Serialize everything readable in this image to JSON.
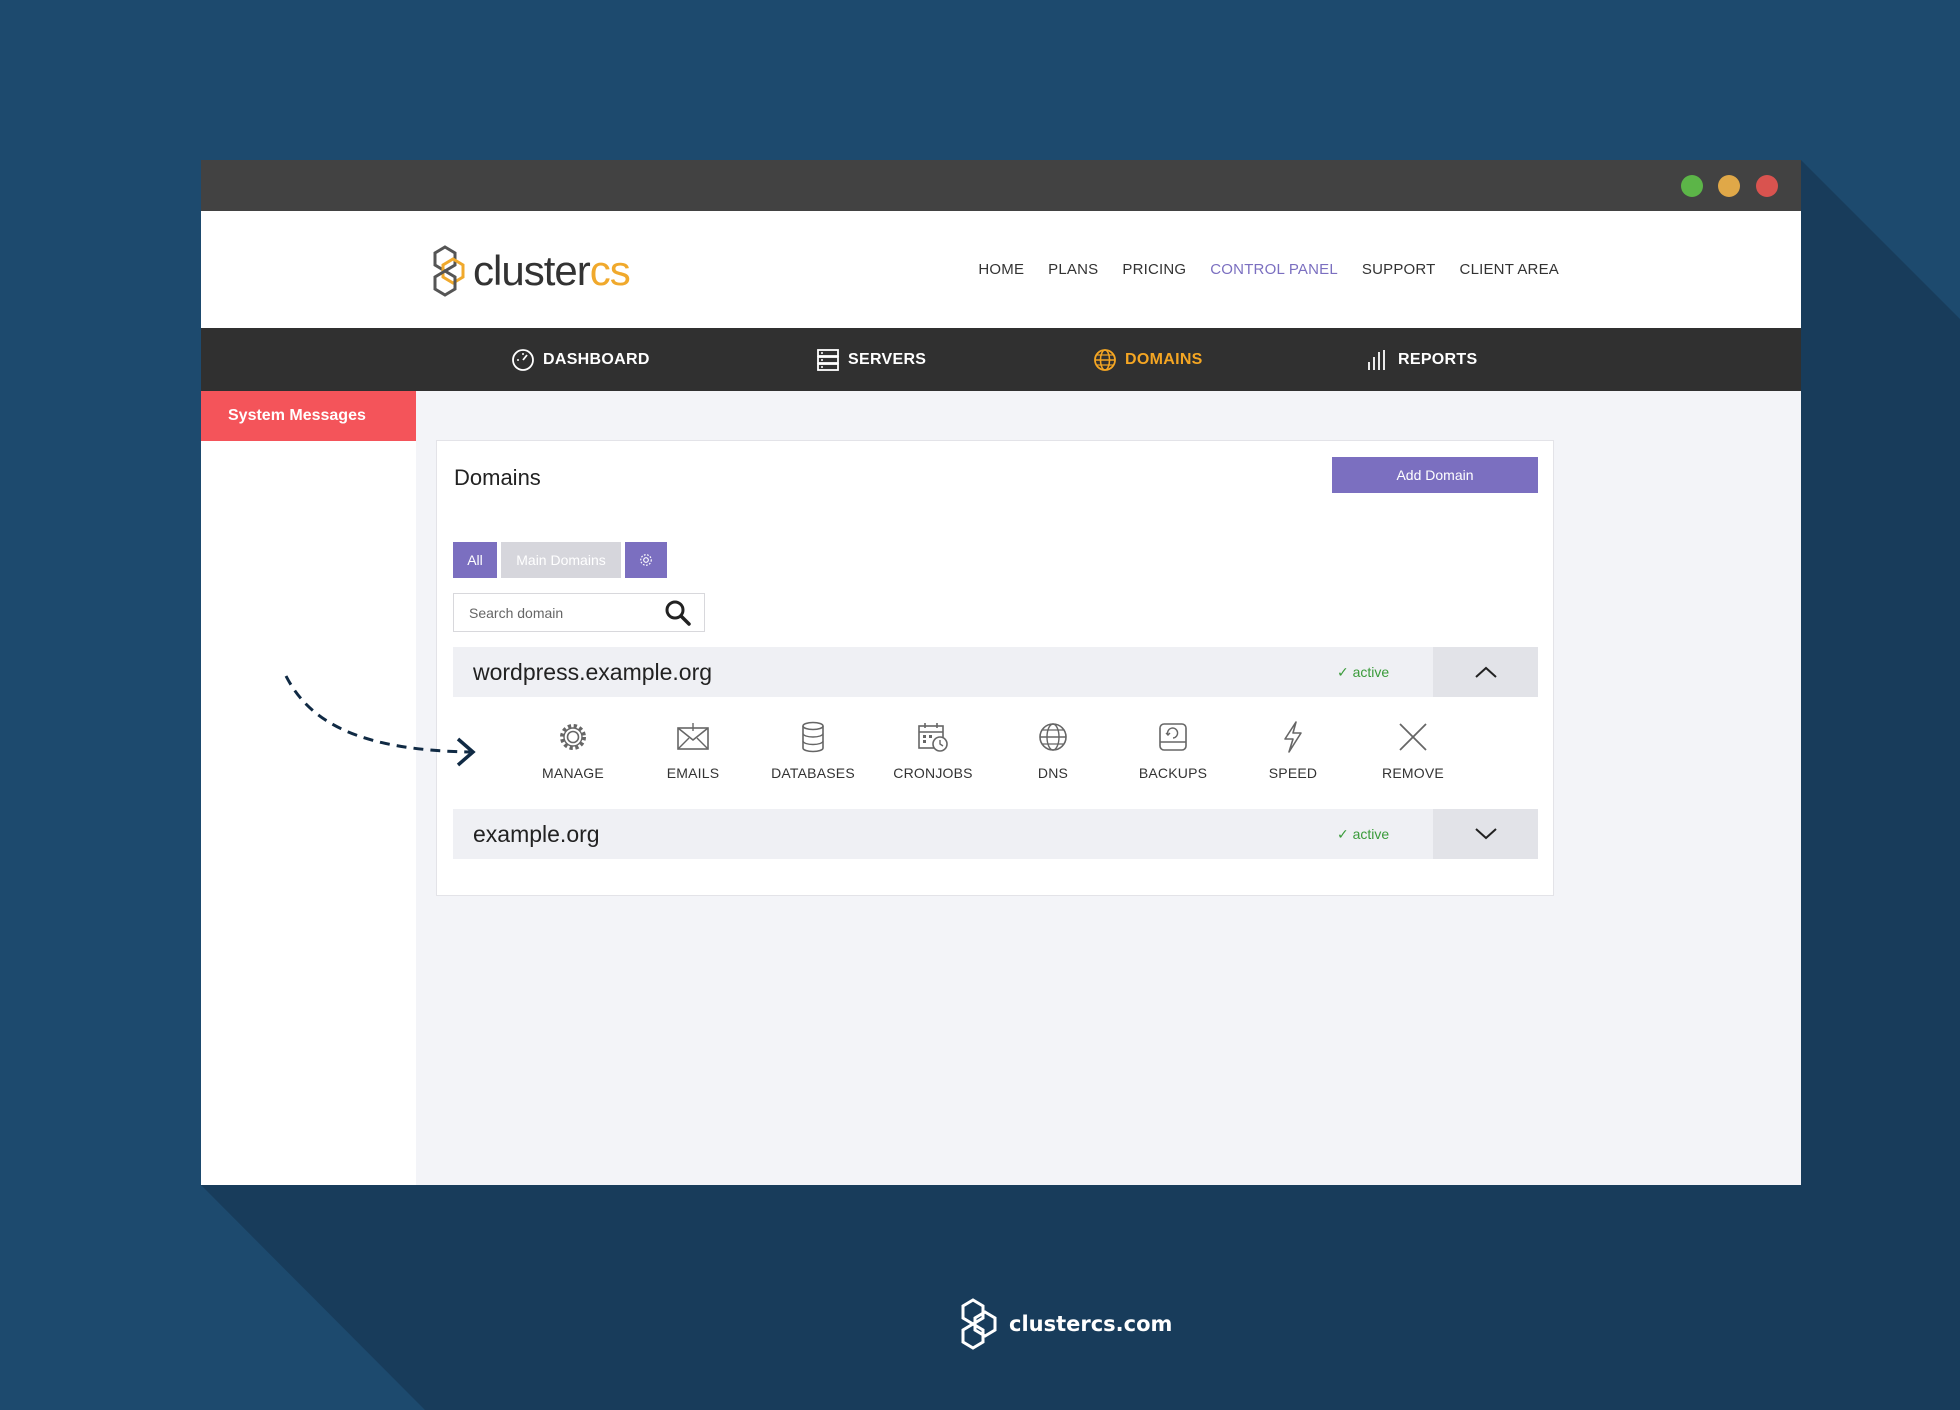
{
  "window": {
    "controls": [
      "maximize",
      "minimize",
      "close"
    ]
  },
  "header": {
    "logo": {
      "text_main": "cluster",
      "text_accent": "cs"
    },
    "nav": [
      {
        "label": "HOME",
        "active": false
      },
      {
        "label": "PLANS",
        "active": false
      },
      {
        "label": "PRICING",
        "active": false
      },
      {
        "label": "CONTROL PANEL",
        "active": true
      },
      {
        "label": "SUPPORT",
        "active": false
      },
      {
        "label": "CLIENT AREA",
        "active": false
      }
    ]
  },
  "mainnav": [
    {
      "label": "DASHBOARD",
      "icon": "dashboard-icon",
      "active": false
    },
    {
      "label": "SERVERS",
      "icon": "servers-icon",
      "active": false
    },
    {
      "label": "DOMAINS",
      "icon": "globe-icon",
      "active": true
    },
    {
      "label": "REPORTS",
      "icon": "bar-chart-icon",
      "active": false
    }
  ],
  "sidebar": {
    "system_messages": "System Messages"
  },
  "card": {
    "title": "Domains",
    "add_button": "Add Domain",
    "filters": {
      "all": "All",
      "main": "Main Domains"
    },
    "search": {
      "placeholder": "Search domain",
      "value": ""
    }
  },
  "domains": [
    {
      "name": "wordpress.example.org",
      "status": "✓ active",
      "expanded": true
    },
    {
      "name": "example.org",
      "status": "✓ active",
      "expanded": false
    }
  ],
  "actions": [
    {
      "label": "MANAGE",
      "icon": "gear-icon"
    },
    {
      "label": "EMAILS",
      "icon": "email-icon"
    },
    {
      "label": "DATABASES",
      "icon": "database-icon"
    },
    {
      "label": "CRONJOBS",
      "icon": "calendar-clock-icon"
    },
    {
      "label": "DNS",
      "icon": "globe-icon"
    },
    {
      "label": "BACKUPS",
      "icon": "backup-icon"
    },
    {
      "label": "SPEED",
      "icon": "lightning-icon"
    },
    {
      "label": "REMOVE",
      "icon": "close-icon"
    }
  ],
  "footer": {
    "text": "clustercs.com"
  },
  "colors": {
    "background": "#1d4a6e",
    "accent_purple": "#7b6fc0",
    "accent_orange": "#f5a623",
    "alert_red": "#f4545a",
    "active_green": "#3a9b3a"
  }
}
